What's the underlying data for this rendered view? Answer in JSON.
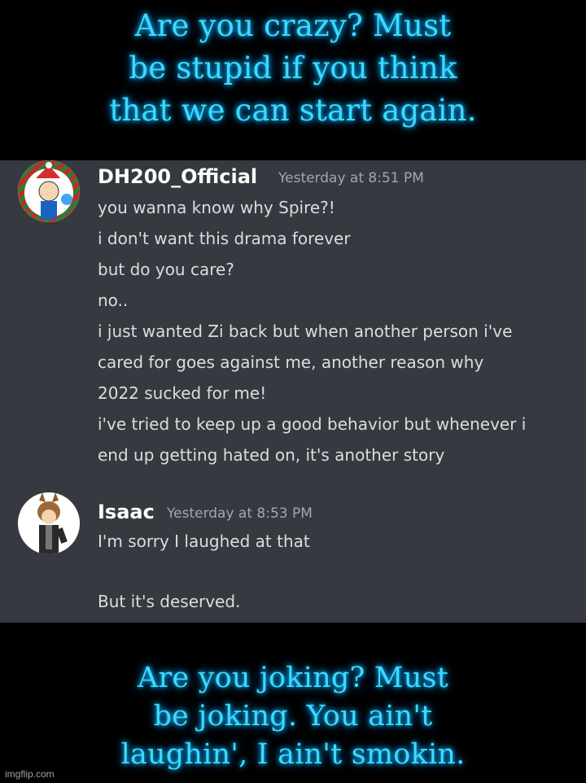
{
  "meme": {
    "top_caption": [
      "Are you crazy? Must",
      "be stupid if you think",
      "that we can start again."
    ],
    "bottom_caption": [
      "Are you joking? Must",
      "be joking. You ain't",
      "laughin', I ain't smokin."
    ],
    "watermark": "imgflip.com"
  },
  "chat": {
    "background": "#36393f",
    "messages": [
      {
        "username": "DH200_Official",
        "timestamp": "Yesterday at 8:51 PM",
        "lines": [
          "you wanna know why Spire?!",
          "i don't want this drama forever",
          "but do you care?",
          "no..",
          "i just wanted Zi back but when another person i've",
          "cared for goes against me, another reason why",
          "2022 sucked for me!",
          "i've tried to keep up a good behavior but whenever i",
          "end up getting hated on, it's another story"
        ]
      },
      {
        "username": "Isaac",
        "timestamp": "Yesterday at 8:53 PM",
        "lines": [
          "I'm sorry I laughed at that",
          "But it's deserved."
        ]
      }
    ]
  },
  "colors": {
    "caption": "#3fd8ff",
    "username": "#ffffff",
    "message": "#dcddde",
    "timestamp": "#a3a6aa"
  }
}
